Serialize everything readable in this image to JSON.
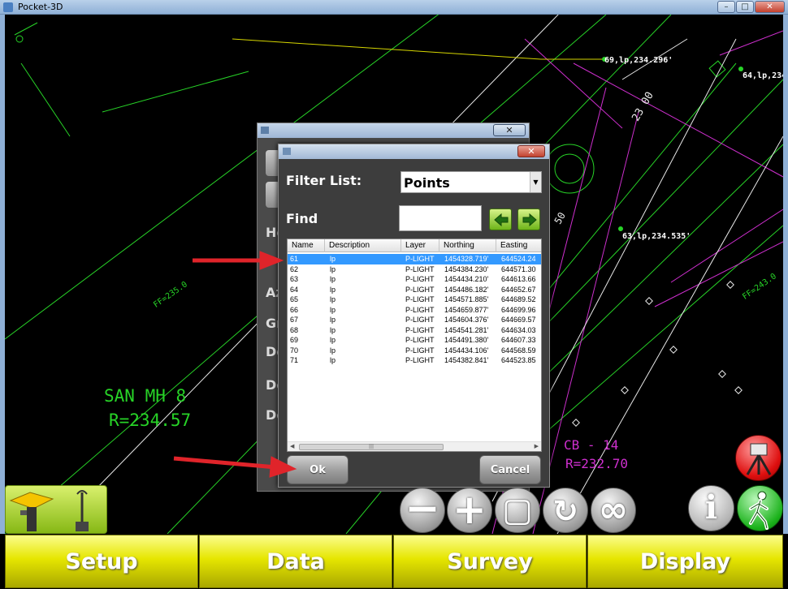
{
  "window": {
    "title": "Pocket-3D",
    "controls": [
      "minimize",
      "maximize",
      "close"
    ]
  },
  "cad": {
    "labels": [
      {
        "id": "san-mh",
        "text": "SAN MH 8"
      },
      {
        "id": "san-r",
        "text": "R=234.57"
      },
      {
        "id": "pt69",
        "text": "69,lp,234.296'"
      },
      {
        "id": "pt64",
        "text": "64,lp,234"
      },
      {
        "id": "pt63",
        "text": "63,lp,234.535'"
      },
      {
        "id": "cb",
        "text": "CB - 14"
      },
      {
        "id": "cb-r",
        "text": "R=232.70"
      },
      {
        "id": "ff-left",
        "text": "FF=235.0"
      },
      {
        "id": "ff-right",
        "text": "FF=243.0"
      },
      {
        "id": "n23",
        "text": "23 00"
      },
      {
        "id": "n50",
        "text": "50"
      }
    ],
    "colors": {
      "green": "#27d327",
      "magenta": "#cf2fcf",
      "white": "#ffffff",
      "red_arrow": "#e0242a"
    }
  },
  "back_dialog": {
    "labels": [
      "He",
      "Az",
      "Gr",
      "De",
      "De",
      "De"
    ]
  },
  "dialog": {
    "filter_label": "Filter List:",
    "filter_value": "Points",
    "find_label": "Find",
    "find_value": "",
    "prev_icon": "arrow-left-icon",
    "next_icon": "arrow-right-icon",
    "columns": [
      "Name",
      "Description",
      "Layer",
      "Northing",
      "Easting"
    ],
    "rows": [
      {
        "name": "61",
        "description": "lp",
        "layer": "P-LIGHT",
        "northing": "1454328.719'",
        "easting": "644524.24",
        "selected": true
      },
      {
        "name": "62",
        "description": "lp",
        "layer": "P-LIGHT",
        "northing": "1454384.230'",
        "easting": "644571.30"
      },
      {
        "name": "63",
        "description": "lp",
        "layer": "P-LIGHT",
        "northing": "1454434.210'",
        "easting": "644613.66"
      },
      {
        "name": "64",
        "description": "lp",
        "layer": "P-LIGHT",
        "northing": "1454486.182'",
        "easting": "644652.67"
      },
      {
        "name": "65",
        "description": "lp",
        "layer": "P-LIGHT",
        "northing": "1454571.885'",
        "easting": "644689.52"
      },
      {
        "name": "66",
        "description": "lp",
        "layer": "P-LIGHT",
        "northing": "1454659.877'",
        "easting": "644699.96"
      },
      {
        "name": "67",
        "description": "lp",
        "layer": "P-LIGHT",
        "northing": "1454604.376'",
        "easting": "644669.57"
      },
      {
        "name": "68",
        "description": "lp",
        "layer": "P-LIGHT",
        "northing": "1454541.281'",
        "easting": "644634.03"
      },
      {
        "name": "69",
        "description": "lp",
        "layer": "P-LIGHT",
        "northing": "1454491.380'",
        "easting": "644607.33"
      },
      {
        "name": "70",
        "description": "lp",
        "layer": "P-LIGHT",
        "northing": "1454434.106'",
        "easting": "644568.59"
      },
      {
        "name": "71",
        "description": "lp",
        "layer": "P-LIGHT",
        "northing": "1454382.841'",
        "easting": "644523.85"
      }
    ],
    "ok_label": "Ok",
    "cancel_label": "Cancel"
  },
  "toolbar": {
    "zoom_out": "−",
    "zoom_in": "+",
    "zoom_extent": "▢",
    "rotate": "↻",
    "infinity": "∞",
    "info": "i"
  },
  "tabs": [
    "Setup",
    "Data",
    "Survey",
    "Display"
  ]
}
